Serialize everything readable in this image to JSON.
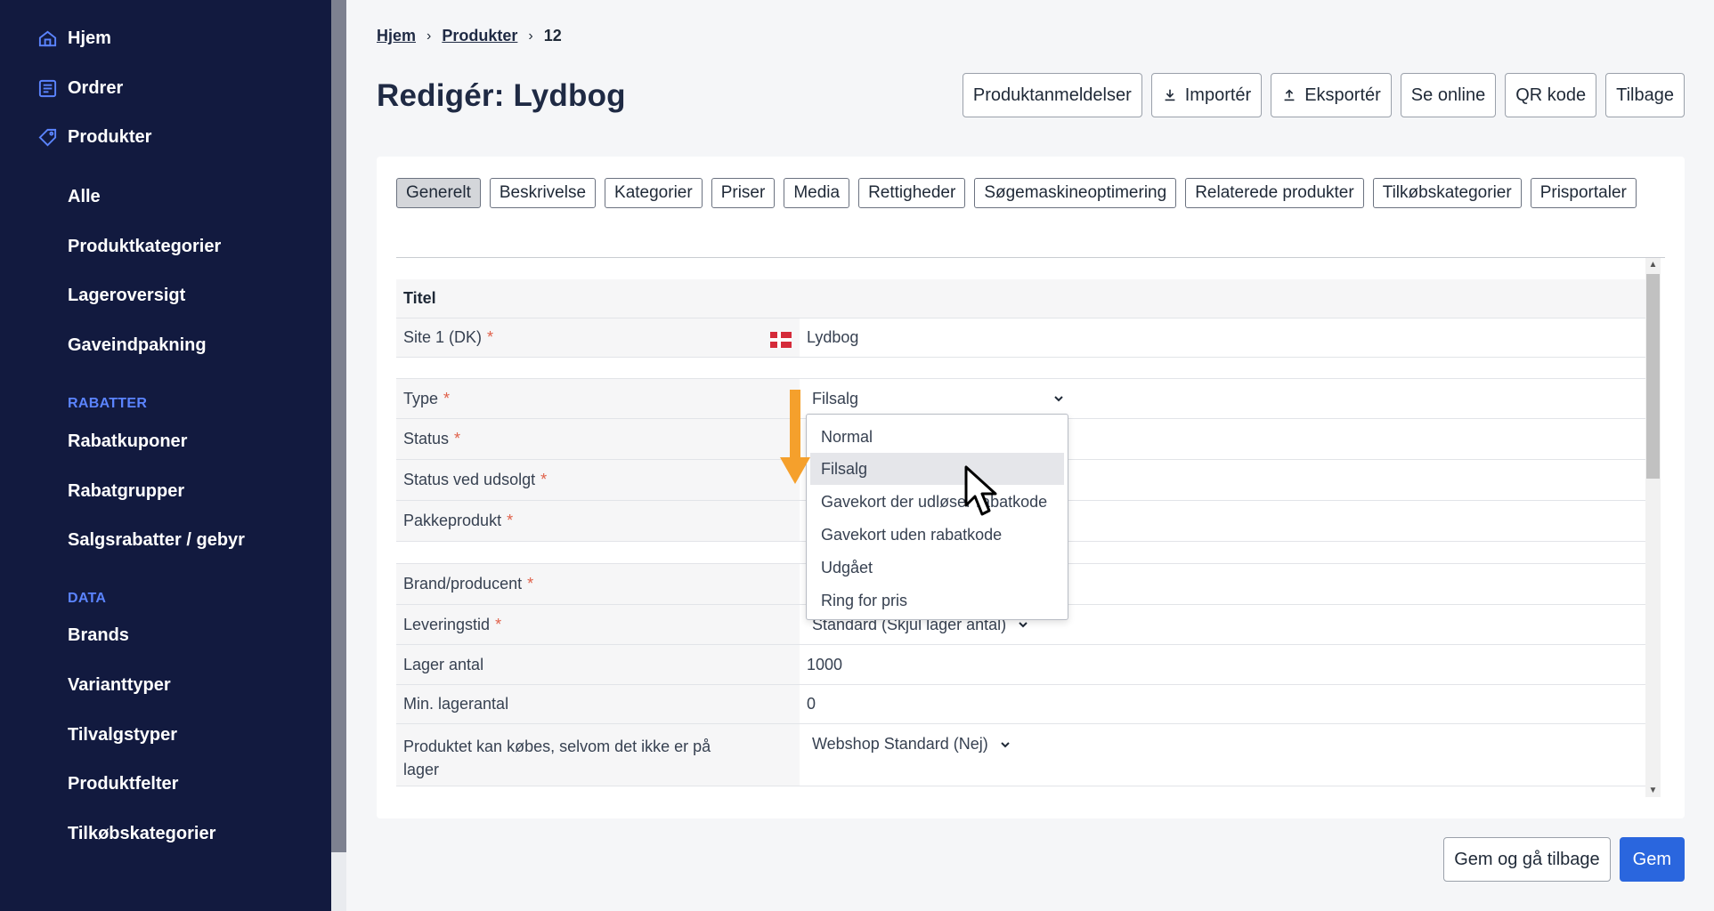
{
  "sidebar": {
    "top_items": [
      {
        "label": "Hjem",
        "icon": "home-icon"
      },
      {
        "label": "Ordrer",
        "icon": "list-icon"
      },
      {
        "label": "Produkter",
        "icon": "tag-icon"
      }
    ],
    "product_items": [
      "Alle",
      "Produktkategorier",
      "Lageroversigt",
      "Gaveindpakning"
    ],
    "sections": {
      "discounts": {
        "title": "RABATTER",
        "items": [
          "Rabatkuponer",
          "Rabatgrupper",
          "Salgsrabatter / gebyr"
        ]
      },
      "data": {
        "title": "DATA",
        "items": [
          "Brands",
          "Varianttyper",
          "Tilvalgstyper",
          "Produktfelter",
          "Tilkøbskategorier"
        ]
      }
    },
    "colors": {
      "background": "#121a3f",
      "accent": "#5b84ff"
    }
  },
  "breadcrumb": {
    "home": "Hjem",
    "products": "Produkter",
    "current": "12",
    "separator": "›"
  },
  "page_title": "Redigér: Lydbog",
  "toolbar": {
    "reviews": "Produktanmeldelser",
    "import": "Importér",
    "export": "Eksportér",
    "online": "Se online",
    "qr": "QR kode",
    "back": "Tilbage"
  },
  "tabs": [
    "Generelt",
    "Beskrivelse",
    "Kategorier",
    "Priser",
    "Media",
    "Rettigheder",
    "Søgemaskineoptimering",
    "Relaterede produkter",
    "Tilkøbskategorier",
    "Prisportaler"
  ],
  "active_tab": "Generelt",
  "form": {
    "title_section": "Titel",
    "site_label": "Site 1 (DK)",
    "site_value": "Lydbog",
    "required_mark": "*",
    "type_label": "Type",
    "type_value": "Filsalg",
    "status_label": "Status",
    "status_soldout_label": "Status ved udsolgt",
    "package_label": "Pakkeprodukt",
    "brand_label": "Brand/producent",
    "delivery_label": "Leveringstid",
    "delivery_value": "Standard (Skjul lager antal)",
    "stock_label": "Lager antal",
    "stock_value": "1000",
    "min_stock_label": "Min. lagerantal",
    "min_stock_value": "0",
    "buy_oos_label": "Produktet kan købes, selvom det ikke er på lager",
    "buy_oos_value": "Webshop Standard (Nej)"
  },
  "type_dropdown": {
    "options": [
      "Normal",
      "Filsalg",
      "Gavekort der udløser rabatkode",
      "Gavekort uden rabatkode",
      "Udgået",
      "Ring for pris"
    ],
    "highlighted": "Filsalg"
  },
  "actions": {
    "save_back": "Gem og gå tilbage",
    "save": "Gem"
  },
  "colors": {
    "primary": "#2a66de",
    "required": "#e0614a",
    "annotation_arrow": "#f5a02c"
  }
}
